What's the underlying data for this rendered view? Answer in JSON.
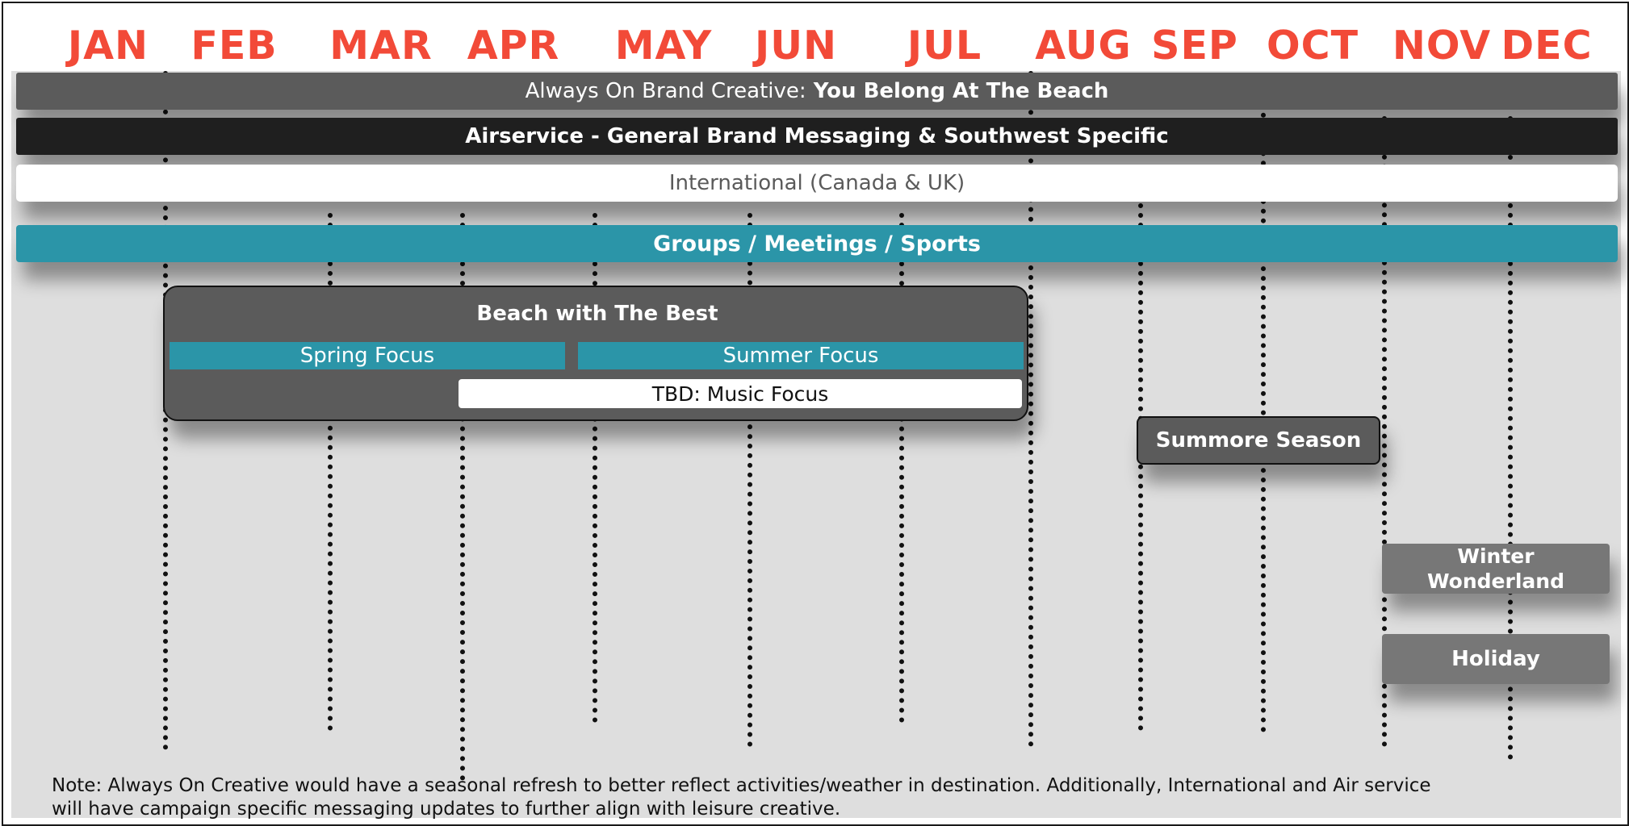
{
  "months": [
    "JAN",
    "FEB",
    "MAR",
    "APR",
    "MAY",
    "JUN",
    "JUL",
    "AUG",
    "SEP",
    "OCT",
    "NOV",
    "DEC"
  ],
  "bars": {
    "always_on_prefix": "Always On Brand Creative: ",
    "always_on_emphasis": "You Belong At The Beach",
    "airservice": "Airservice - General Brand Messaging & Southwest Specific",
    "international": "International (Canada & UK)",
    "groups": "Groups / Meetings / Sports"
  },
  "campaign": {
    "title": "Beach with The Best",
    "spring": "Spring Focus",
    "summer": "Summer Focus",
    "tbd": "TBD: Music Focus"
  },
  "seasonal": {
    "summore": "Summore Season",
    "winter": "Winter\nWonderland",
    "holiday": "Holiday"
  },
  "note": "Note: Always On Creative would have a seasonal refresh to better reflect activities/weather in destination. Additionally, International and Air service will have campaign specific messaging updates to further align with leisure creative.",
  "colors": {
    "month_label": "#f24a38",
    "teal": "#2b95a8",
    "dark_gray": "#5b5b5b",
    "black_bar": "#1f1f1f",
    "light_gray": "#777777",
    "background": "#dedede"
  }
}
